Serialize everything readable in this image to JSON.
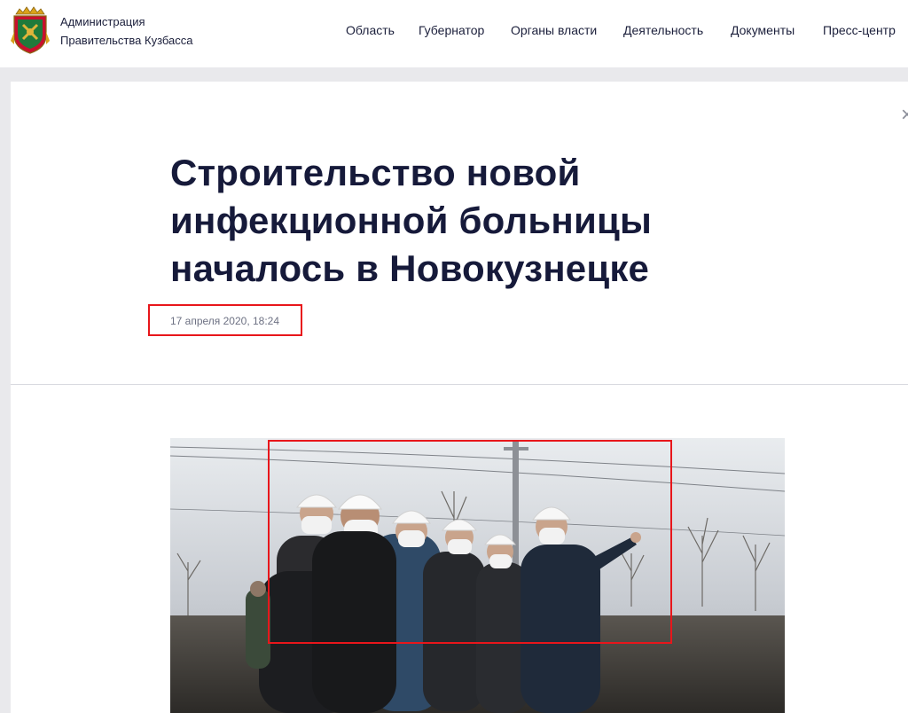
{
  "header": {
    "org_line1": "Администрация",
    "org_line2": "Правительства Кузбасса",
    "logo": "kuzbass-coat-of-arms",
    "nav": [
      "Область",
      "Губернатор",
      "Органы власти",
      "Деятельность",
      "Документы",
      "Пресс-центр"
    ]
  },
  "article": {
    "title_lines": [
      "Строительство новой",
      "инфекционной больницы",
      "началось в Новокузнецке"
    ],
    "date": "17 апреля 2020, 18:24",
    "close_icon": "×"
  },
  "colors": {
    "text": "#1b1f3b",
    "highlight": "#e8161b",
    "page_bg": "#e9e9ec"
  }
}
